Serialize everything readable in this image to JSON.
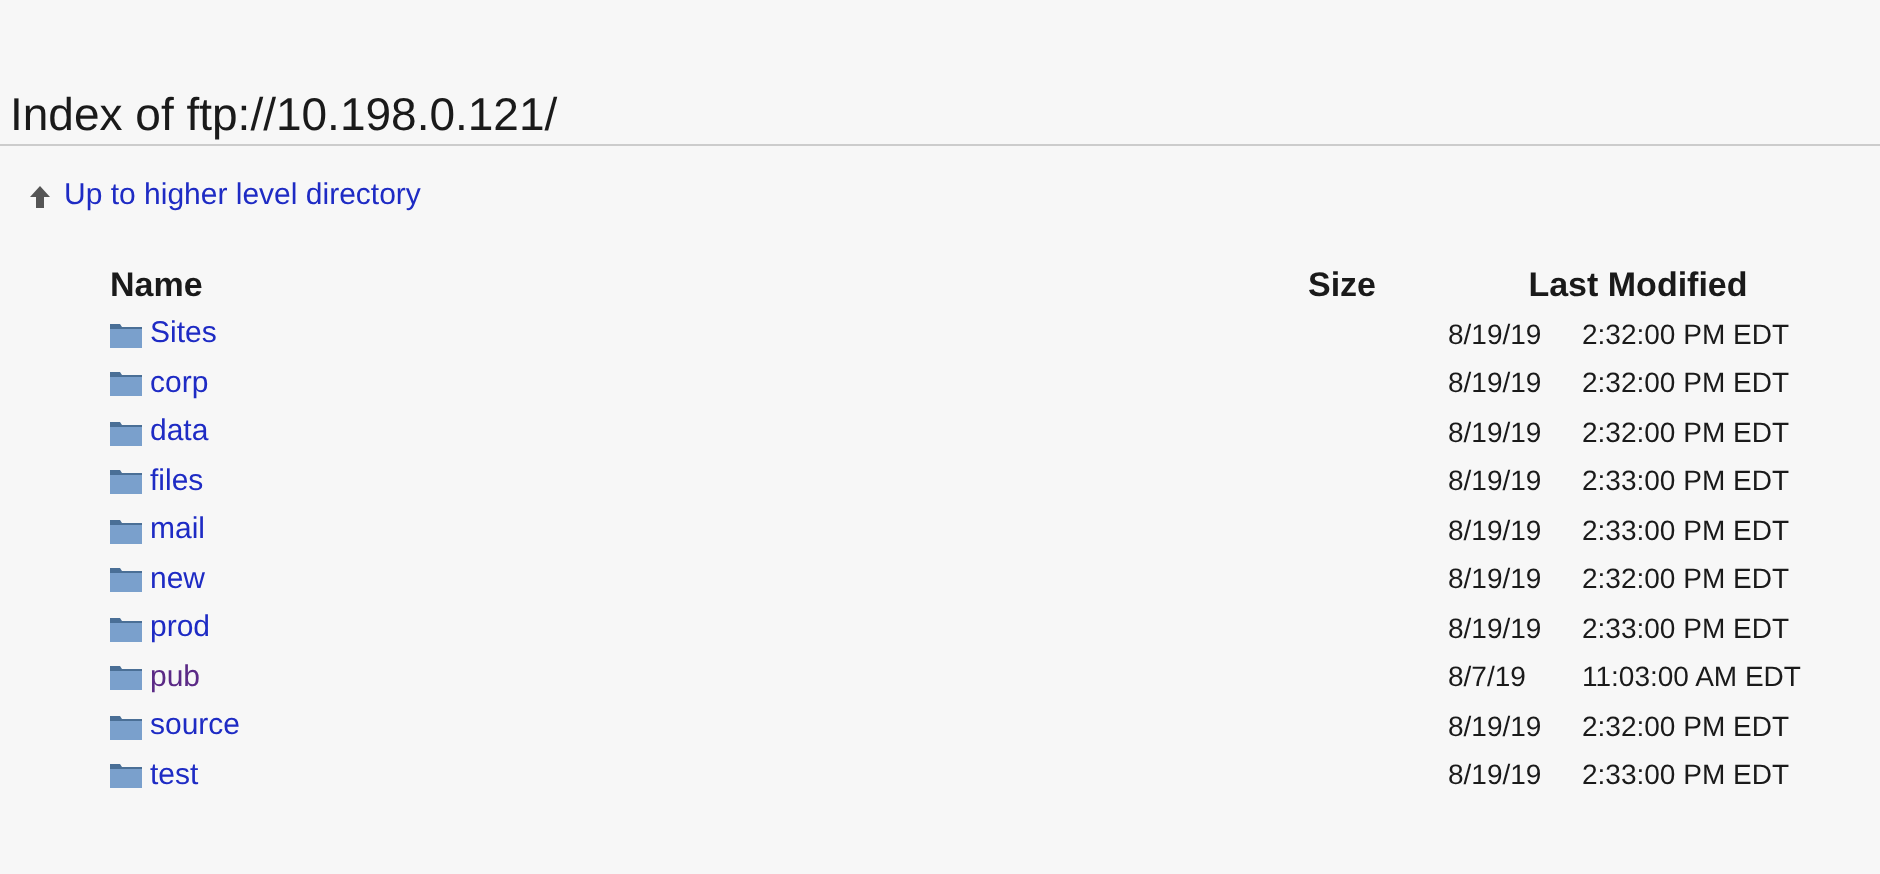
{
  "title": "Index of ftp://10.198.0.121/",
  "up_link": "Up to higher level directory",
  "table": {
    "columns": [
      "Name",
      "Size",
      "Last Modified"
    ],
    "rows": [
      {
        "name": "Sites",
        "visited": false,
        "date": "8/19/19",
        "time": "2:32:00 PM EDT"
      },
      {
        "name": "corp",
        "visited": false,
        "date": "8/19/19",
        "time": "2:32:00 PM EDT"
      },
      {
        "name": "data",
        "visited": false,
        "date": "8/19/19",
        "time": "2:32:00 PM EDT"
      },
      {
        "name": "files",
        "visited": false,
        "date": "8/19/19",
        "time": "2:33:00 PM EDT"
      },
      {
        "name": "mail",
        "visited": false,
        "date": "8/19/19",
        "time": "2:33:00 PM EDT"
      },
      {
        "name": "new",
        "visited": false,
        "date": "8/19/19",
        "time": "2:32:00 PM EDT"
      },
      {
        "name": "prod",
        "visited": false,
        "date": "8/19/19",
        "time": "2:33:00 PM EDT"
      },
      {
        "name": "pub",
        "visited": true,
        "date": "8/7/19",
        "time": "11:03:00 AM EDT"
      },
      {
        "name": "source",
        "visited": false,
        "date": "8/19/19",
        "time": "2:32:00 PM EDT"
      },
      {
        "name": "test",
        "visited": false,
        "date": "8/19/19",
        "time": "2:33:00 PM EDT"
      }
    ]
  }
}
